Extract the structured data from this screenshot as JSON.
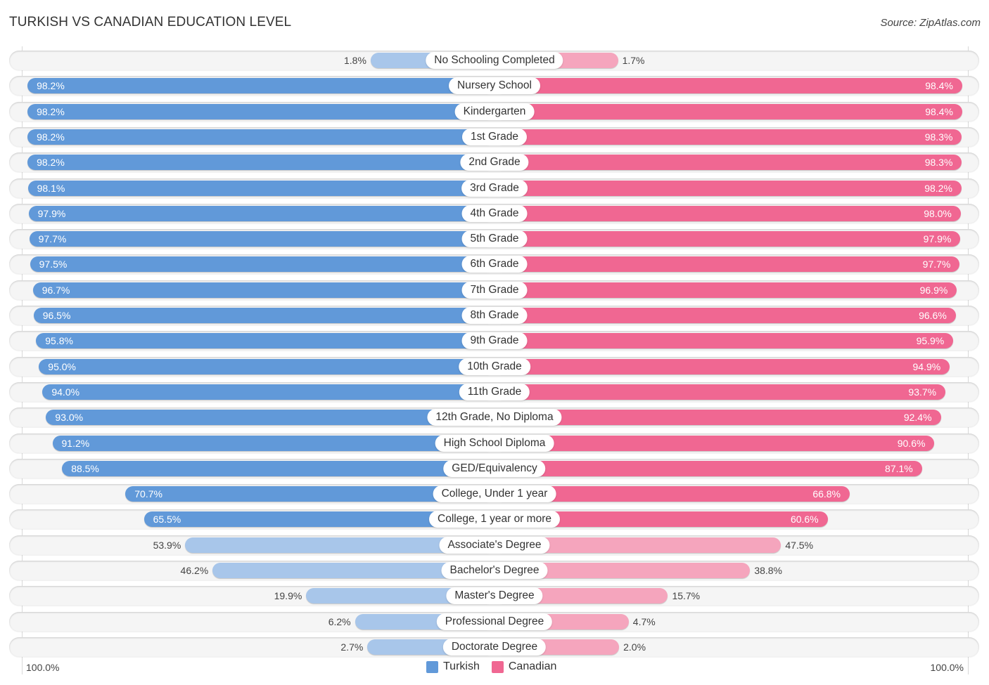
{
  "header": {
    "title": "TURKISH VS CANADIAN EDUCATION LEVEL",
    "source": "Source: ZipAtlas.com"
  },
  "colors": {
    "turkish": "#6199d9",
    "turkish_light": "#a8c6ea",
    "canadian": "#f06792",
    "canadian_light": "#f5a5bd"
  },
  "legend": {
    "items": [
      {
        "label": "Turkish",
        "color": "#6199d9"
      },
      {
        "label": "Canadian",
        "color": "#f06792"
      }
    ]
  },
  "axis": {
    "left_label": "100.0%",
    "right_label": "100.0%"
  },
  "chart_data": {
    "type": "bar",
    "orientation": "horizontal-diverging",
    "title": "TURKISH VS CANADIAN EDUCATION LEVEL",
    "xlabel": "",
    "ylabel": "",
    "xlim": [
      0,
      100
    ],
    "legend_position": "bottom-center",
    "grid": false,
    "categories": [
      "No Schooling Completed",
      "Nursery School",
      "Kindergarten",
      "1st Grade",
      "2nd Grade",
      "3rd Grade",
      "4th Grade",
      "5th Grade",
      "6th Grade",
      "7th Grade",
      "8th Grade",
      "9th Grade",
      "10th Grade",
      "11th Grade",
      "12th Grade, No Diploma",
      "High School Diploma",
      "GED/Equivalency",
      "College, Under 1 year",
      "College, 1 year or more",
      "Associate's Degree",
      "Bachelor's Degree",
      "Master's Degree",
      "Professional Degree",
      "Doctorate Degree"
    ],
    "series": [
      {
        "name": "Turkish",
        "values": [
          1.8,
          98.2,
          98.2,
          98.2,
          98.2,
          98.1,
          97.9,
          97.7,
          97.5,
          96.7,
          96.5,
          95.8,
          95.0,
          94.0,
          93.0,
          91.2,
          88.5,
          70.7,
          65.5,
          53.9,
          46.2,
          19.9,
          6.2,
          2.7
        ],
        "labels": [
          "1.8%",
          "98.2%",
          "98.2%",
          "98.2%",
          "98.2%",
          "98.1%",
          "97.9%",
          "97.7%",
          "97.5%",
          "96.7%",
          "96.5%",
          "95.8%",
          "95.0%",
          "94.0%",
          "93.0%",
          "91.2%",
          "88.5%",
          "70.7%",
          "65.5%",
          "53.9%",
          "46.2%",
          "19.9%",
          "6.2%",
          "2.7%"
        ]
      },
      {
        "name": "Canadian",
        "values": [
          1.7,
          98.4,
          98.4,
          98.3,
          98.3,
          98.2,
          98.0,
          97.9,
          97.7,
          96.9,
          96.6,
          95.9,
          94.9,
          93.7,
          92.4,
          90.6,
          87.1,
          66.8,
          60.6,
          47.5,
          38.8,
          15.7,
          4.7,
          2.0
        ],
        "labels": [
          "1.7%",
          "98.4%",
          "98.4%",
          "98.3%",
          "98.3%",
          "98.2%",
          "98.0%",
          "97.9%",
          "97.7%",
          "96.9%",
          "96.6%",
          "95.9%",
          "94.9%",
          "93.7%",
          "92.4%",
          "90.6%",
          "87.1%",
          "66.8%",
          "60.6%",
          "47.5%",
          "38.8%",
          "15.7%",
          "4.7%",
          "2.0%"
        ]
      }
    ]
  }
}
